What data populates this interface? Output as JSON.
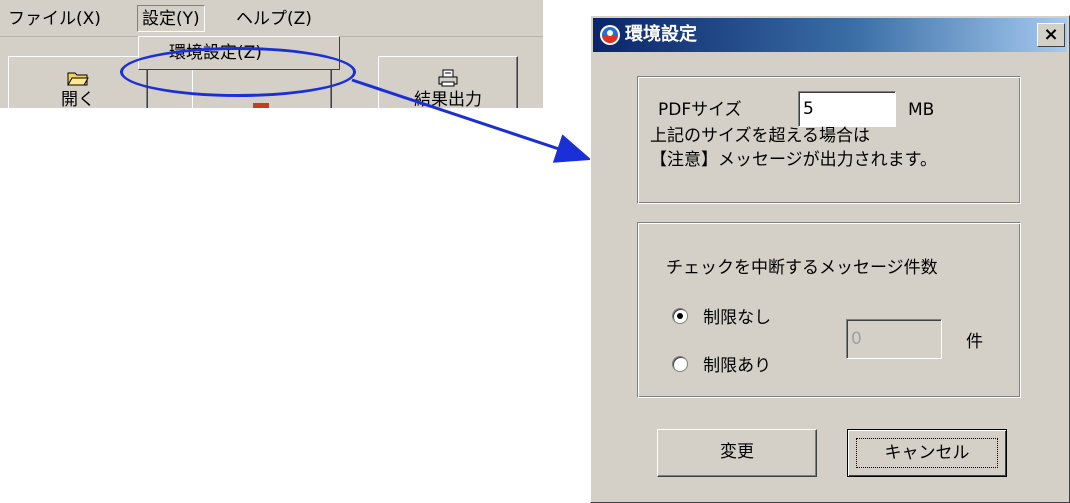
{
  "menu": {
    "file_label": "ファイル(X)",
    "settings_label": "設定(Y)",
    "help_label": "ヘルプ(Z)",
    "dropdown_env_label": "環境設定(Z)"
  },
  "toolbar": {
    "open_label": "開く",
    "mid_label": "",
    "print_label": "結果出力"
  },
  "annotation": {
    "highlight_color": "#1a2fd6"
  },
  "dialog": {
    "title": "環境設定",
    "close_glyph": "×",
    "pdf_size_label": "PDFサイズ",
    "pdf_size_value": "5",
    "pdf_size_unit": "MB",
    "note_line1": "上記のサイズを超える場合は",
    "note_line2": "【注意】メッセージが出力されます。",
    "check_group_title": "チェックを中断するメッセージ件数",
    "radio_unlimited": "制限なし",
    "radio_limited": "制限あり",
    "limit_count_value": "0",
    "limit_count_unit": "件",
    "change_button": "変更",
    "cancel_button": "キャンセル",
    "selected_option": "制限なし"
  }
}
